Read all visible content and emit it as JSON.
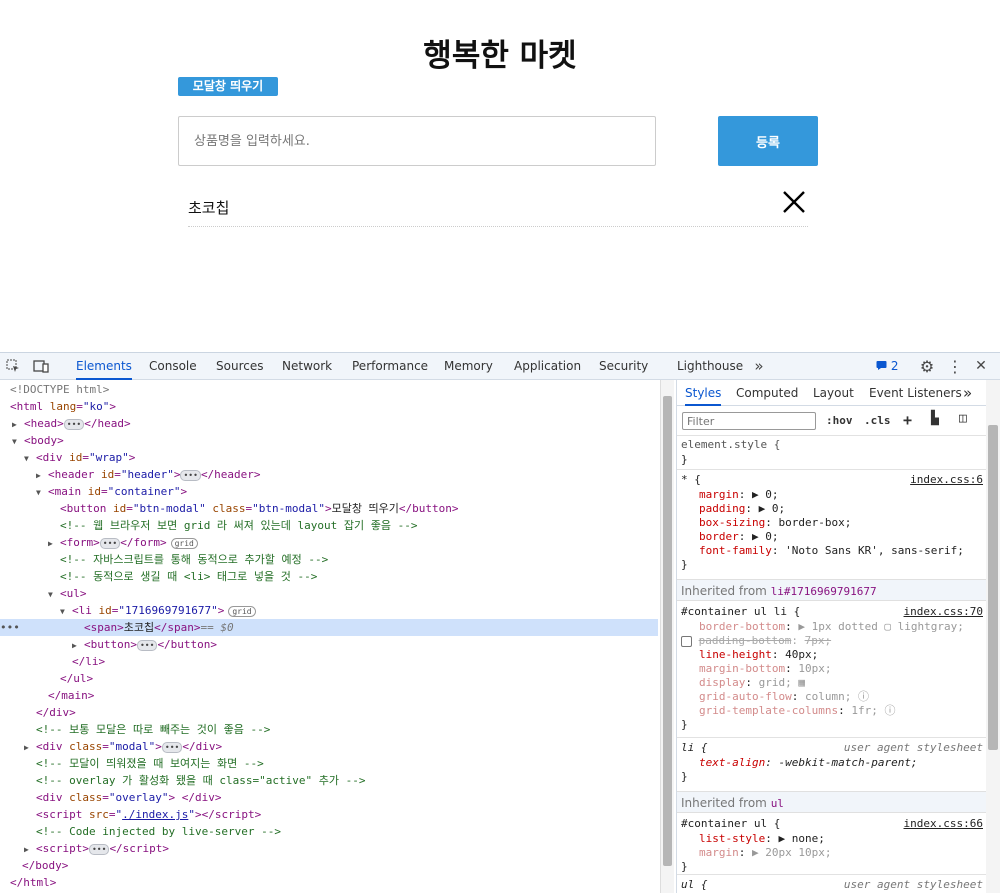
{
  "page": {
    "title": "행복한 마켓",
    "modal_button": "모달창 띄우기",
    "input_placeholder": "상품명을 입력하세요.",
    "submit_button": "등록",
    "list": [
      {
        "text": "초코칩",
        "delete_glyph": "✕"
      }
    ],
    "accent_color": "#3498db"
  },
  "devtools": {
    "tabs": [
      "Elements",
      "Console",
      "Sources",
      "Network",
      "Performance",
      "Memory",
      "Application",
      "Security",
      "Lighthouse"
    ],
    "active_tab": "Elements",
    "issues_count": "2",
    "dom_tree": {
      "doctype": "<!DOCTYPE html>",
      "html": "<html lang=\"ko\">",
      "head": "head",
      "body": "body",
      "wrap_id": "wrap",
      "header_id": "header",
      "main_id": "container",
      "button_id": "btn-modal",
      "button_class": "btn-modal",
      "button_text": "모달창 띄우기",
      "comment_grid": "<!-- 웹 브라우저 보면 grid 라 써져 있는데 layout 잡기 좋음 -->",
      "comment_js": "<!-- 자바스크립트를 통해 동적으로 추가할 예정 -->",
      "comment_li": "<!-- 동적으로 생길 때 <li> 태그로 넣을 것 -->",
      "li_id": "1716969791677",
      "span_text": "초코칩",
      "selected_marker": "== $0",
      "comment_modal": "<!-- 보통 모달은 따로 빼주는 것이 좋음 -->",
      "modal_class": "modal",
      "comment_overlay": "<!-- 모달이 띄워졌을 때 보여지는 화면 -->",
      "comment_active": "<!-- overlay 가 활성화 됐을 때 class=\"active\" 추가 -->",
      "overlay_class": "overlay",
      "script_src": "./index.js",
      "comment_live": "<!-- Code injected by live-server -->",
      "grid_badge": "grid",
      "ellipsis": "…"
    },
    "styles": {
      "tabs": [
        "Styles",
        "Computed",
        "Layout",
        "Event Listeners"
      ],
      "active_tab": "Styles",
      "filter_placeholder": "Filter",
      "hov": ":hov",
      "cls": ".cls",
      "element_style": "element.style {",
      "close_brace": "}",
      "universal": {
        "selector": "* {",
        "source": "index.css:6",
        "props": [
          {
            "name": "margin",
            "value": "▶ 0;"
          },
          {
            "name": "padding",
            "value": "▶ 0;"
          },
          {
            "name": "box-sizing",
            "value": "border-box;"
          },
          {
            "name": "border",
            "value": "▶ 0;"
          },
          {
            "name": "font-family",
            "value": "'Noto Sans KR', sans-serif;"
          }
        ]
      },
      "inherited_li_label": "Inherited from",
      "inherited_li_selector": "li#1716969791677",
      "li_rule": {
        "selector": "#container ul li {",
        "source": "index.css:70",
        "props": [
          {
            "name": "border-bottom",
            "value": "▶ 1px dotted ▢ lightgray;"
          },
          {
            "name": "padding-bottom",
            "value": "7px;"
          },
          {
            "name": "line-height",
            "value": "40px;"
          },
          {
            "name": "margin-bottom",
            "value": "10px;"
          },
          {
            "name": "display",
            "value": "grid;"
          },
          {
            "name": "grid-auto-flow",
            "value": "column;"
          },
          {
            "name": "grid-template-columns",
            "value": "1fr;"
          }
        ]
      },
      "ua_li": {
        "selector": "li {",
        "source": "user agent stylesheet",
        "props": [
          {
            "name": "text-align",
            "value": "-webkit-match-parent;"
          }
        ]
      },
      "inherited_ul_label": "Inherited from",
      "inherited_ul_selector": "ul",
      "ul_rule": {
        "selector": "#container ul {",
        "source": "index.css:66",
        "props": [
          {
            "name": "list-style",
            "value": "▶ none;"
          },
          {
            "name": "margin",
            "value": "▶ 20px 10px;"
          }
        ]
      },
      "ua_ul": {
        "selector": "ul {",
        "source": "user agent stylesheet"
      }
    }
  }
}
